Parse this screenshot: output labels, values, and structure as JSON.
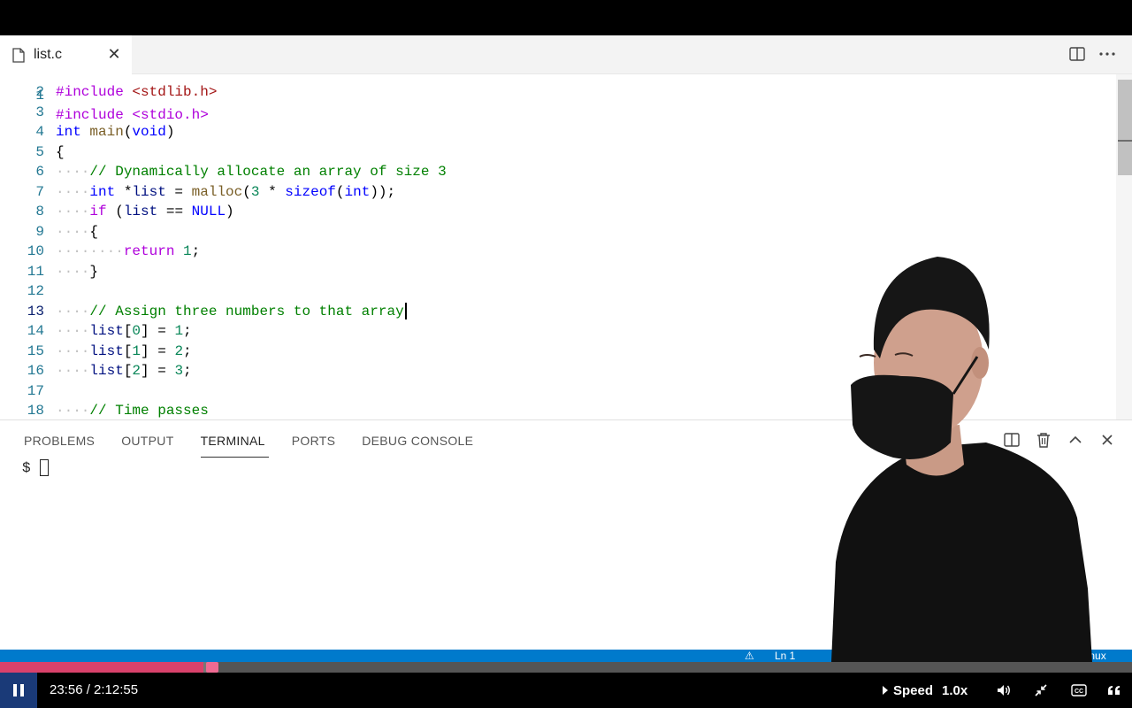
{
  "editor": {
    "tab": {
      "filename": "list.c",
      "close_glyph": "✕"
    },
    "icons": {
      "file": "file-icon",
      "split": "split-editor-icon",
      "more": "more-actions-icon"
    },
    "cut_line": "#include <stdio.h>",
    "lines": [
      {
        "n": "2",
        "segs": [
          [
            "kwc",
            "#include "
          ],
          [
            "str",
            "<stdlib.h>"
          ]
        ]
      },
      {
        "n": "3",
        "segs": []
      },
      {
        "n": "4",
        "segs": [
          [
            "ty",
            "int "
          ],
          [
            "fn",
            "main"
          ],
          [
            "",
            "("
          ],
          [
            "ty",
            "void"
          ],
          [
            "",
            ")"
          ]
        ]
      },
      {
        "n": "5",
        "segs": [
          [
            "",
            "{"
          ]
        ]
      },
      {
        "n": "6",
        "segs": [
          [
            "ws",
            "····"
          ],
          [
            "cm",
            "// Dynamically allocate an array of size 3"
          ]
        ]
      },
      {
        "n": "7",
        "segs": [
          [
            "ws",
            "····"
          ],
          [
            "ty",
            "int "
          ],
          [
            "",
            "*"
          ],
          [
            "id",
            "list"
          ],
          [
            "",
            " = "
          ],
          [
            "fn",
            "malloc"
          ],
          [
            "",
            "("
          ],
          [
            "num",
            "3"
          ],
          [
            "",
            " * "
          ],
          [
            "kw",
            "sizeof"
          ],
          [
            "",
            "("
          ],
          [
            "ty",
            "int"
          ],
          [
            "",
            "));"
          ]
        ]
      },
      {
        "n": "8",
        "segs": [
          [
            "ws",
            "····"
          ],
          [
            "kwc",
            "if "
          ],
          [
            "",
            "("
          ],
          [
            "id",
            "list"
          ],
          [
            "",
            " == "
          ],
          [
            "kw",
            "NULL"
          ],
          [
            "",
            ")"
          ]
        ]
      },
      {
        "n": "9",
        "segs": [
          [
            "ws",
            "····"
          ],
          [
            "",
            "{"
          ]
        ]
      },
      {
        "n": "10",
        "segs": [
          [
            "ws",
            "········"
          ],
          [
            "kwc",
            "return "
          ],
          [
            "num",
            "1"
          ],
          [
            "",
            ";"
          ]
        ]
      },
      {
        "n": "11",
        "segs": [
          [
            "ws",
            "····"
          ],
          [
            "",
            "}"
          ]
        ]
      },
      {
        "n": "12",
        "segs": []
      },
      {
        "n": "13",
        "active": true,
        "cursor": true,
        "segs": [
          [
            "ws",
            "····"
          ],
          [
            "cm",
            "// Assign three numbers to that array"
          ]
        ]
      },
      {
        "n": "14",
        "segs": [
          [
            "ws",
            "····"
          ],
          [
            "id",
            "list"
          ],
          [
            "",
            "["
          ],
          [
            "num",
            "0"
          ],
          [
            "",
            "] = "
          ],
          [
            "num",
            "1"
          ],
          [
            "",
            ";"
          ]
        ]
      },
      {
        "n": "15",
        "segs": [
          [
            "ws",
            "····"
          ],
          [
            "id",
            "list"
          ],
          [
            "",
            "["
          ],
          [
            "num",
            "1"
          ],
          [
            "",
            "] = "
          ],
          [
            "num",
            "2"
          ],
          [
            "",
            ";"
          ]
        ]
      },
      {
        "n": "16",
        "segs": [
          [
            "ws",
            "····"
          ],
          [
            "id",
            "list"
          ],
          [
            "",
            "["
          ],
          [
            "num",
            "2"
          ],
          [
            "",
            "] = "
          ],
          [
            "num",
            "3"
          ],
          [
            "",
            ";"
          ]
        ]
      },
      {
        "n": "17",
        "segs": []
      },
      {
        "n": "18",
        "segs": [
          [
            "ws",
            "····"
          ],
          [
            "cm",
            "// Time passes"
          ]
        ]
      }
    ]
  },
  "panel": {
    "tabs": [
      "PROBLEMS",
      "OUTPUT",
      "TERMINAL",
      "PORTS",
      "DEBUG CONSOLE"
    ],
    "active_tab": "TERMINAL",
    "prompt": "$",
    "icons": [
      "split-terminal-icon",
      "trash-icon",
      "chevron-up-icon",
      "close-icon"
    ]
  },
  "statusbar": {
    "position_text": "Ln 1",
    "os_text": "Linux",
    "warning_icon": "warning-icon"
  },
  "video": {
    "current_time": "23:56",
    "duration": "2:12:55",
    "time_text": "23:56 / 2:12:55",
    "progress_fraction": 0.18,
    "buffer_fraction": 0.19,
    "speed_label": "Speed",
    "speed_value": "1.0x",
    "icons": [
      "pause-icon",
      "volume-icon",
      "exit-fullscreen-icon",
      "captions-icon",
      "transcript-icon"
    ]
  },
  "colors": {
    "accent": "#007acc",
    "progress": "#d9416b",
    "play_button": "#1a3a78"
  }
}
